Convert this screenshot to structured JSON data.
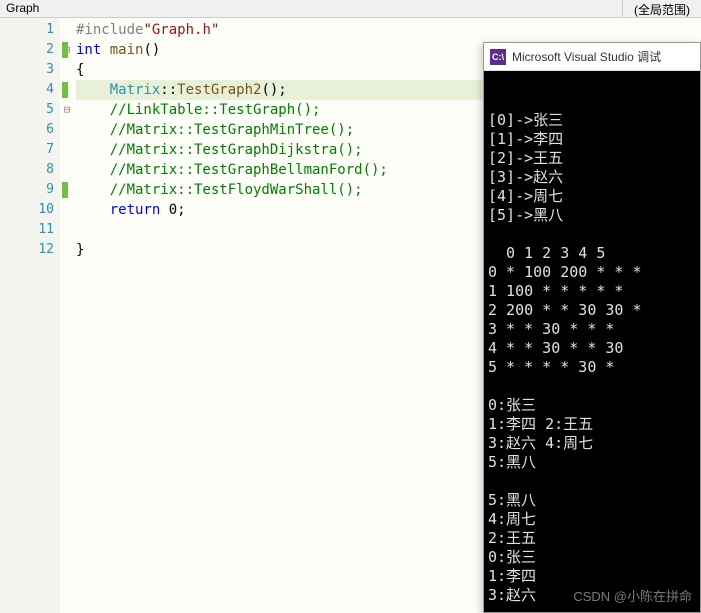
{
  "topbar": {
    "left": "Graph",
    "right": "(全局范围)"
  },
  "gutter": [
    "1",
    "2",
    "3",
    "4",
    "5",
    "6",
    "7",
    "8",
    "9",
    "10",
    "11",
    "12"
  ],
  "markers": {
    "2": true,
    "4": true,
    "9": true
  },
  "fold": {
    "2": "⊟",
    "5": "⊟"
  },
  "highlight_line": 4,
  "code": {
    "l1": {
      "pp": "#include",
      "str": "\"Graph.h\""
    },
    "l2": {
      "kw1": "int",
      "fn": " main",
      "rest": "()"
    },
    "l3": "{",
    "l4": {
      "indent": "    ",
      "cls": "Matrix",
      "sep": "::",
      "fn": "TestGraph2",
      "rest": "();"
    },
    "l5": "    //LinkTable::TestGraph();",
    "l6": "    //Matrix::TestGraphMinTree();",
    "l7": "    //Matrix::TestGraphDijkstra();",
    "l8": "    //Matrix::TestGraphBellmanFord();",
    "l9": "    //Matrix::TestFloydWarShall();",
    "l10": {
      "indent": "    ",
      "kw": "return",
      "rest": " 0;"
    },
    "l11": "",
    "l12": "}"
  },
  "console": {
    "icon": "C:\\",
    "title": "Microsoft Visual Studio 调试",
    "lines": [
      "[0]->张三",
      "[1]->李四",
      "[2]->王五",
      "[3]->赵六",
      "[4]->周七",
      "[5]->黑八",
      "",
      "  0 1 2 3 4 5",
      "0 * 100 200 * * *",
      "1 100 * * * * *",
      "2 200 * * 30 30 *",
      "3 * * 30 * * *",
      "4 * * 30 * * 30",
      "5 * * * * 30 *",
      "",
      "0:张三",
      "1:李四 2:王五",
      "3:赵六 4:周七",
      "5:黑八",
      "",
      "5:黑八",
      "4:周七",
      "2:王五",
      "0:张三",
      "1:李四",
      "3:赵六"
    ],
    "watermark": "CSDN @​小陈在拼命​"
  },
  "chart_data": {
    "type": "table",
    "title": "Adjacency Matrix (weighted graph)",
    "vertices": [
      {
        "index": 0,
        "name": "张三"
      },
      {
        "index": 1,
        "name": "李四"
      },
      {
        "index": 2,
        "name": "王五"
      },
      {
        "index": 3,
        "name": "赵六"
      },
      {
        "index": 4,
        "name": "周七"
      },
      {
        "index": 5,
        "name": "黑八"
      }
    ],
    "col_headers": [
      "0",
      "1",
      "2",
      "3",
      "4",
      "5"
    ],
    "row_headers": [
      "0",
      "1",
      "2",
      "3",
      "4",
      "5"
    ],
    "matrix": [
      [
        "*",
        100,
        200,
        "*",
        "*",
        "*"
      ],
      [
        100,
        "*",
        "*",
        "*",
        "*",
        "*"
      ],
      [
        200,
        "*",
        "*",
        30,
        30,
        "*"
      ],
      [
        "*",
        "*",
        30,
        "*",
        "*",
        "*"
      ],
      [
        "*",
        "*",
        30,
        "*",
        "*",
        30
      ],
      [
        "*",
        "*",
        "*",
        "*",
        30,
        "*"
      ]
    ],
    "traversal_bfs_pairs": [
      [
        0,
        "张三"
      ],
      [
        1,
        "李四"
      ],
      [
        2,
        "王五"
      ],
      [
        3,
        "赵六"
      ],
      [
        4,
        "周七"
      ],
      [
        5,
        "黑八"
      ]
    ],
    "traversal_reverse": [
      [
        5,
        "黑八"
      ],
      [
        4,
        "周七"
      ],
      [
        2,
        "王五"
      ],
      [
        0,
        "张三"
      ],
      [
        1,
        "李四"
      ],
      [
        3,
        "赵六"
      ]
    ]
  }
}
